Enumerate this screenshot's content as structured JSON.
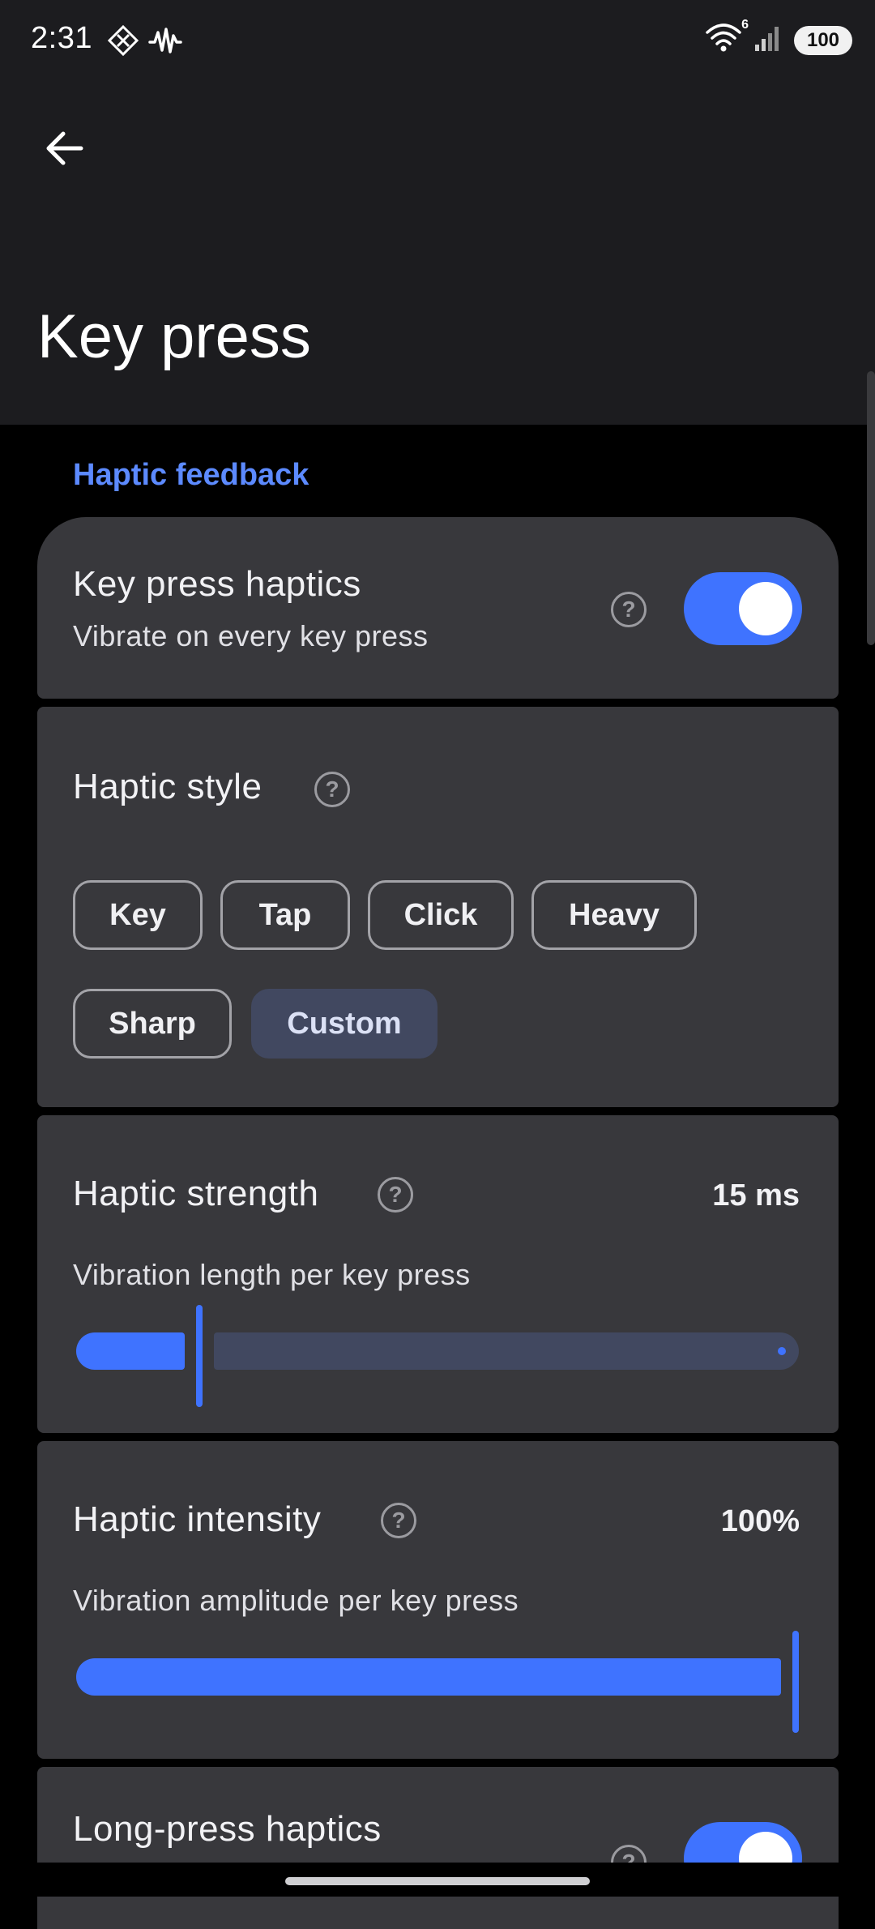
{
  "status_bar": {
    "time": "2:31",
    "battery": "100",
    "left_icons": [
      "app-diamond-icon",
      "activity-wave-icon"
    ],
    "right_icons": [
      "wifi-icon",
      "signal-icon",
      "battery-icon"
    ],
    "wifi_badge": "6"
  },
  "app_bar": {
    "back_icon": "arrow-left-icon",
    "title": "Key press"
  },
  "section": {
    "header": "Haptic feedback"
  },
  "key_press_haptics": {
    "title": "Key press haptics",
    "subtitle": "Vibrate on every key press",
    "help_glyph": "?",
    "enabled": true
  },
  "haptic_style": {
    "title": "Haptic style",
    "help_glyph": "?",
    "options": [
      "Key",
      "Tap",
      "Click",
      "Heavy",
      "Sharp",
      "Custom"
    ],
    "selected": "Custom"
  },
  "haptic_strength": {
    "title": "Haptic strength",
    "help_glyph": "?",
    "value_label": "15 ms",
    "subtitle": "Vibration length per key press",
    "fraction": 0.17
  },
  "haptic_intensity": {
    "title": "Haptic intensity",
    "help_glyph": "?",
    "value_label": "100%",
    "subtitle": "Vibration amplitude per key press",
    "fraction": 1.0
  },
  "long_press_haptics": {
    "title": "Long-press haptics",
    "help_glyph": "?",
    "enabled": true
  },
  "colors": {
    "accent": "#3f73ff",
    "section_header": "#5c8aff",
    "card_bg": "#38383c",
    "topbar_bg": "#1c1c1f",
    "page_bg": "#000000",
    "selected_chip": "#414860"
  }
}
